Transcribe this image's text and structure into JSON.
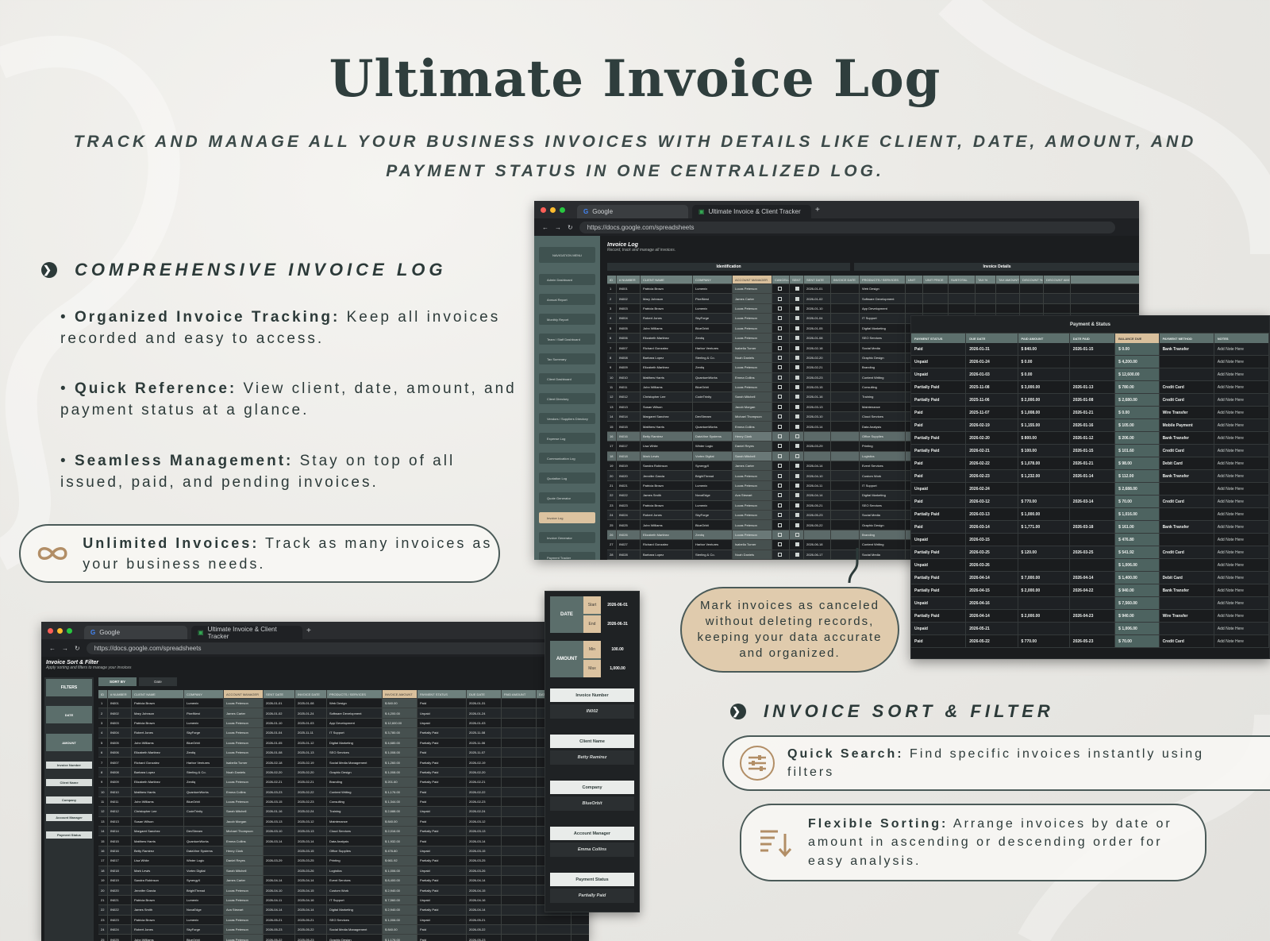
{
  "header": {
    "title": "Ultimate Invoice Log",
    "subtitle": "TRACK AND MANAGE ALL YOUR BUSINESS INVOICES WITH DETAILS LIKE CLIENT, DATE, AMOUNT, AND PAYMENT STATUS IN ONE CENTRALIZED LOG."
  },
  "section1": {
    "heading": "COMPREHENSIVE INVOICE LOG",
    "bullets": [
      {
        "bold": "Organized Invoice Tracking:",
        "text": " Keep all invoices recorded and easy to access."
      },
      {
        "bold": "Quick Reference:",
        "text": " View client, date, amount, and payment status at a glance."
      },
      {
        "bold": "Seamless Management:",
        "text": " Stay on top of all issued, paid, and pending invoices."
      }
    ],
    "pill": {
      "bold": "Unlimited Invoices:",
      "text": " Track as many invoices as your business needs.",
      "icon": "infinity-icon"
    }
  },
  "callout": "Mark invoices as canceled without deleting records, keeping your data accurate and organized.",
  "section2": {
    "heading": "INVOICE SORT & FILTER",
    "items": [
      {
        "bold": "Quick Search:",
        "text": " Find specific invoices instantly using filters",
        "icon": "sliders-icon"
      },
      {
        "bold": "Flexible Sorting:",
        "text": " Arrange invoices by date or amount in ascending or descending order for easy analysis.",
        "icon": "sort-icon"
      }
    ]
  },
  "browser_top": {
    "tab1": "Google",
    "tab2": "Ultimate Invoice & Client Tracker",
    "url": "https://docs.google.com/spreadsheets",
    "sheet_title": "Invoice Log",
    "sheet_subtitle": "Record, track and manage all invoices.",
    "group1": "Identification",
    "group2": "Invoice Details",
    "sidebar": [
      "NAVIGATION MENU",
      "Admin Dashboard",
      "Annual Report",
      "Monthly Report",
      "Team / Staff Dashboard",
      "Tax Summary",
      "Client Dashboard",
      "Client Directory",
      "Vendors / Suppliers Directory",
      "Expense Log",
      "Communication Log",
      "Quotation Log",
      "Quote Generator",
      "Invoice Log",
      "Invoice Generator",
      "Payment Tracker"
    ],
    "columns": [
      "ID",
      "# NUMBER",
      "CLIENT NAME",
      "COMPANY",
      "ACCOUNT MANAGER",
      "CANCELLED",
      "SENT",
      "SENT DATE",
      "INVOICE DATE",
      "PRODUCTS / SERVICES",
      "UNIT",
      "UNIT PRICE",
      "SUBTOTAL",
      "TAX %",
      "TAX AMOUNT",
      "DISCOUNT %",
      "DISCOUNT AMOUNT"
    ],
    "rows": [
      [
        "1",
        "IN001",
        "Patricia Brown",
        "Lumenix",
        "Lucas Peterson",
        "2026-01-01",
        "Web Design"
      ],
      [
        "2",
        "IN002",
        "Mary Johnson",
        "PixelNest",
        "James Carter",
        "2026-01-02",
        "Software Development"
      ],
      [
        "3",
        "IN003",
        "Patricia Brown",
        "Lumenix",
        "Lucas Peterson",
        "2026-01-10",
        "App Development"
      ],
      [
        "4",
        "IN004",
        "Robert Jones",
        "SkyForge",
        "Lucas Peterson",
        "2026-01-04",
        "IT Support"
      ],
      [
        "5",
        "IN005",
        "John Williams",
        "BlueOrbit",
        "Lucas Peterson",
        "2026-01-05",
        "Digital Marketing"
      ],
      [
        "6",
        "IN006",
        "Elizabeth Martinez",
        "Zentiq",
        "Lucas Peterson",
        "2026-01-08",
        "SEO Services"
      ],
      [
        "7",
        "IN007",
        "Richard Gonzalez",
        "Harbor Ventures",
        "Isabella Turner",
        "2026-02-18",
        "Social Media"
      ],
      [
        "8",
        "IN008",
        "Barbara Lopez",
        "Sterling & Co.",
        "Noah Daniels",
        "2026-02-20",
        "Graphic Design"
      ],
      [
        "9",
        "IN009",
        "Elizabeth Martinez",
        "Zentiq",
        "Lucas Peterson",
        "2026-02-21",
        "Branding"
      ],
      [
        "10",
        "IN010",
        "Matthew Harris",
        "QuantumWorks",
        "Emma Collins",
        "2026-03-23",
        "Content Writing"
      ],
      [
        "11",
        "IN011",
        "John Williams",
        "BlueOrbit",
        "Lucas Peterson",
        "2026-03-15",
        "Consulting"
      ],
      [
        "12",
        "IN012",
        "Christopher Lee",
        "CodeTrinity",
        "Sarah Mitchell",
        "2026-01-16",
        "Training"
      ],
      [
        "13",
        "IN013",
        "Susan Wilson",
        "",
        "Jacob Morgan",
        "2026-03-13",
        "Maintenance"
      ],
      [
        "14",
        "IN014",
        "Margaret Sanchez",
        "DevStream",
        "Michael Thompson",
        "2026-03-10",
        "Cloud Services"
      ],
      [
        "15",
        "IN015",
        "Matthew Harris",
        "QuantumWorks",
        "Emma Collins",
        "2026-03-14",
        "Data Analysis"
      ],
      [
        "16",
        "IN016",
        "Betty Ramirez",
        "DataVine Systems",
        "Henry Clark",
        "",
        "Office Supplies"
      ],
      [
        "17",
        "IN017",
        "Lisa White",
        "Winter Logic",
        "Daniel Reyes",
        "2026-03-29",
        "Printing"
      ],
      [
        "18",
        "IN018",
        "Mark Lewis",
        "Vortex Digital",
        "Sarah Mitchell",
        "",
        "Logistics"
      ],
      [
        "19",
        "IN019",
        "Sandra Robinson",
        "SynergyX",
        "James Carter",
        "2026-04-14",
        "Event Services"
      ],
      [
        "20",
        "IN020",
        "Jennifer Garcia",
        "BrightThread",
        "Lucas Peterson",
        "2026-04-10",
        "Custom Work"
      ],
      [
        "21",
        "IN021",
        "Patricia Brown",
        "Lumenix",
        "Lucas Peterson",
        "2026-04-11",
        "IT Support"
      ],
      [
        "22",
        "IN022",
        "James Smith",
        "NovaEdge",
        "Ava Stewart",
        "2026-04-14",
        "Digital Marketing"
      ],
      [
        "23",
        "IN023",
        "Patricia Brown",
        "Lumenix",
        "Lucas Peterson",
        "2026-05-21",
        "SEO Services"
      ],
      [
        "24",
        "IN024",
        "Robert Jones",
        "SkyForge",
        "Lucas Peterson",
        "2026-05-23",
        "Social Media"
      ],
      [
        "25",
        "IN025",
        "John Williams",
        "BlueOrbit",
        "Lucas Peterson",
        "2026-05-22",
        "Graphic Design"
      ],
      [
        "26",
        "IN026",
        "Elizabeth Martinez",
        "Zentiq",
        "Lucas Peterson",
        "",
        "Branding"
      ],
      [
        "27",
        "IN027",
        "Richard Gonzalez",
        "Harbor Ventures",
        "Isabella Turner",
        "2026-06-18",
        "Content Writing"
      ],
      [
        "28",
        "IN028",
        "Barbara Lopez",
        "Sterling & Co.",
        "Noah Daniels",
        "2026-06-17",
        "Social Media"
      ]
    ]
  },
  "payment_status": {
    "title": "Payment & Status",
    "columns": [
      "PAYMENT STATUS",
      "DUE DATE",
      "PAID AMOUNT",
      "DATE PAID",
      "BALANCE DUE",
      "PAYMENT METHOD",
      "NOTES"
    ],
    "rows": [
      [
        "Paid",
        "2026-01-31",
        "$ 840.00",
        "2026-01-15",
        "$ 0.00",
        "Bank Transfer",
        "Add Note Here"
      ],
      [
        "Unpaid",
        "2026-01-24",
        "$ 0.00",
        "",
        "$ 4,200.00",
        "",
        "Add Note Here"
      ],
      [
        "Unpaid",
        "2026-01-03",
        "$ 0.00",
        "",
        "$ 12,600.00",
        "",
        "Add Note Here"
      ],
      [
        "Partially Paid",
        "2025-11-08",
        "$ 3,000.00",
        "2026-01-13",
        "$ 780.00",
        "Credit Card",
        "Add Note Here"
      ],
      [
        "Partially Paid",
        "2025-11-06",
        "$ 2,000.00",
        "2026-01-08",
        "$ 2,680.00",
        "Credit Card",
        "Add Note Here"
      ],
      [
        "Paid",
        "2025-11-07",
        "$ 1,008.00",
        "2026-01-21",
        "$ 0.00",
        "Wire Transfer",
        "Add Note Here"
      ],
      [
        "Paid",
        "2026-02-19",
        "$ 1,155.00",
        "2026-01-16",
        "$ 105.00",
        "Mobile Payment",
        "Add Note Here"
      ],
      [
        "Partially Paid",
        "2026-02-20",
        "$ 800.00",
        "2026-01-12",
        "$ 206.00",
        "Bank Transfer",
        "Add Note Here"
      ],
      [
        "Partially Paid",
        "2026-02-21",
        "$ 100.00",
        "2026-01-15",
        "$ 101.60",
        "Credit Card",
        "Add Note Here"
      ],
      [
        "Paid",
        "2026-02-22",
        "$ 1,078.00",
        "2026-01-21",
        "$ 98.00",
        "Debit Card",
        "Add Note Here"
      ],
      [
        "Paid",
        "2026-02-23",
        "$ 1,232.00",
        "2026-01-14",
        "$ 112.00",
        "Bank Transfer",
        "Add Note Here"
      ],
      [
        "Unpaid",
        "2026-02-24",
        "",
        "",
        "$ 2,688.00",
        "",
        "Add Note Here"
      ],
      [
        "Paid",
        "2026-03-12",
        "$ 770.00",
        "2026-03-14",
        "$ 70.00",
        "Credit Card",
        "Add Note Here"
      ],
      [
        "Partially Paid",
        "2026-03-13",
        "$ 1,000.00",
        "",
        "$ 1,016.00",
        "",
        "Add Note Here"
      ],
      [
        "Paid",
        "2026-03-14",
        "$ 1,771.00",
        "2026-03-18",
        "$ 161.00",
        "Bank Transfer",
        "Add Note Here"
      ],
      [
        "Unpaid",
        "2026-03-15",
        "",
        "",
        "$ 476.80",
        "",
        "Add Note Here"
      ],
      [
        "Partially Paid",
        "2026-03-25",
        "$ 120.00",
        "2026-03-25",
        "$ 541.92",
        "Credit Card",
        "Add Note Here"
      ],
      [
        "Unpaid",
        "2026-03-26",
        "",
        "",
        "$ 1,006.00",
        "",
        "Add Note Here"
      ],
      [
        "Partially Paid",
        "2026-04-14",
        "$ 7,000.00",
        "2026-04-14",
        "$ 1,400.00",
        "Debit Card",
        "Add Note Here"
      ],
      [
        "Partially Paid",
        "2026-04-15",
        "$ 2,000.00",
        "2026-04-22",
        "$ 940.00",
        "Bank Transfer",
        "Add Note Here"
      ],
      [
        "Unpaid",
        "2026-04-16",
        "",
        "",
        "$ 7,560.00",
        "",
        "Add Note Here"
      ],
      [
        "Partially Paid",
        "2026-04-14",
        "$ 2,000.00",
        "2026-04-23",
        "$ 940.00",
        "Wire Transfer",
        "Add Note Here"
      ],
      [
        "Unpaid",
        "2026-05-21",
        "",
        "",
        "$ 1,006.00",
        "",
        "Add Note Here"
      ],
      [
        "Paid",
        "2026-05-22",
        "$ 770.00",
        "2026-05-23",
        "$ 70.00",
        "Credit Card",
        "Add Note Here"
      ]
    ]
  },
  "browser_bottom": {
    "tab1": "Google",
    "tab2": "Ultimate Invoice & Client Tracker",
    "url": "https://docs.google.com/spreadsheets",
    "sheet_title": "Invoice Sort & Filter",
    "sheet_subtitle": "Apply sorting and filters to manage your invoices",
    "sort_by": "SORT BY",
    "sort_value": "Date",
    "filters_label": "FILTERS",
    "side_filters": [
      "DATE",
      "AMOUNT",
      "Invoice Number",
      "Client Name",
      "Company",
      "Account Manager",
      "Payment Status"
    ],
    "columns": [
      "ID",
      "# NUMBER",
      "CLIENT NAME",
      "COMPANY",
      "ACCOUNT MANAGER",
      "SENT DATE",
      "INVOICE DATE",
      "PRODUCTS / SERVICES",
      "INVOICE AMOUNT",
      "PAYMENT STATUS",
      "DUE DATE",
      "PAID AMOUNT",
      "DATE PAID"
    ],
    "rows": [
      [
        "1",
        "IN001",
        "Patricia Brown",
        "Lumenix",
        "Lucas Peterson",
        "2026-01-01",
        "2025-01-08",
        "Web Design",
        "$ 840.00",
        "Paid",
        "2026-01-31"
      ],
      [
        "2",
        "IN002",
        "Mary Johnson",
        "PixelNest",
        "James Carter",
        "2026-01-02",
        "2025-01-24",
        "Software Development",
        "$ 4,200.00",
        "Unpaid",
        "2026-01-24"
      ],
      [
        "3",
        "IN003",
        "Patricia Brown",
        "Lumenix",
        "Lucas Peterson",
        "2026-01-10",
        "2025-01-03",
        "App Development",
        "$ 12,600.00",
        "Unpaid",
        "2026-01-03"
      ],
      [
        "4",
        "IN004",
        "Robert Jones",
        "SkyForge",
        "Lucas Peterson",
        "2026-01-04",
        "2025-11-11",
        "IT Support",
        "$ 3,780.00",
        "Partially Paid",
        "2025-11-08"
      ],
      [
        "5",
        "IN005",
        "John Williams",
        "BlueOrbit",
        "Lucas Peterson",
        "2026-01-05",
        "2025-01-12",
        "Digital Marketing",
        "$ 4,680.00",
        "Partially Paid",
        "2025-11-06"
      ],
      [
        "6",
        "IN006",
        "Elizabeth Martinez",
        "Zentiq",
        "Lucas Peterson",
        "2026-01-08",
        "2025-01-13",
        "SEO Services",
        "$ 1,008.00",
        "Paid",
        "2025-11-07"
      ],
      [
        "7",
        "IN007",
        "Richard Gonzalez",
        "Harbor Ventures",
        "Isabella Turner",
        "2026-02-18",
        "2025-02-19",
        "Social Media Management",
        "$ 1,260.00",
        "Partially Paid",
        "2026-02-19"
      ],
      [
        "8",
        "IN008",
        "Barbara Lopez",
        "Sterling & Co.",
        "Noah Daniels",
        "2026-02-20",
        "2025-02-20",
        "Graphic Design",
        "$ 1,008.00",
        "Partially Paid",
        "2026-02-20"
      ],
      [
        "9",
        "IN009",
        "Elizabeth Martinez",
        "Zentiq",
        "Lucas Peterson",
        "2026-02-21",
        "2025-02-21",
        "Branding",
        "$ 201.60",
        "Partially Paid",
        "2026-02-21"
      ],
      [
        "10",
        "IN010",
        "Matthew Harris",
        "QuantumWorks",
        "Emma Collins",
        "2026-03-23",
        "2025-02-22",
        "Content Writing",
        "$ 1,176.00",
        "Paid",
        "2026-02-22"
      ],
      [
        "11",
        "IN011",
        "John Williams",
        "BlueOrbit",
        "Lucas Peterson",
        "2026-03-15",
        "2025-02-23",
        "Consulting",
        "$ 1,344.00",
        "Paid",
        "2026-02-23"
      ],
      [
        "12",
        "IN012",
        "Christopher Lee",
        "CodeTrinity",
        "Sarah Mitchell",
        "2026-01-16",
        "2025-02-24",
        "Training",
        "$ 2,688.00",
        "Unpaid",
        "2026-02-24"
      ],
      [
        "13",
        "IN013",
        "Susan Wilson",
        "",
        "Jacob Morgan",
        "2026-03-13",
        "2025-03-12",
        "Maintenance",
        "$ 840.00",
        "Paid",
        "2026-03-12"
      ],
      [
        "14",
        "IN014",
        "Margaret Sanchez",
        "DevStream",
        "Michael Thompson",
        "2026-03-10",
        "2025-03-13",
        "Cloud Services",
        "$ 2,016.00",
        "Partially Paid",
        "2026-03-13"
      ],
      [
        "15",
        "IN015",
        "Matthew Harris",
        "QuantumWorks",
        "Emma Collins",
        "2026-03-14",
        "2025-03-14",
        "Data Analysis",
        "$ 1,932.00",
        "Paid",
        "2026-03-14"
      ],
      [
        "16",
        "IN016",
        "Betty Ramirez",
        "DataVine Systems",
        "Henry Clark",
        "",
        "2025-03-15",
        "Office Supplies",
        "$ 476.80",
        "Unpaid",
        "2026-03-15"
      ],
      [
        "17",
        "IN017",
        "Lisa White",
        "Winter Logic",
        "Daniel Reyes",
        "2026-03-29",
        "2025-03-25",
        "Printing",
        "$ 661.92",
        "Partially Paid",
        "2026-03-25"
      ],
      [
        "18",
        "IN018",
        "Mark Lewis",
        "Vortex Digital",
        "Sarah Mitchell",
        "",
        "2025-03-26",
        "Logistics",
        "$ 1,006.00",
        "Unpaid",
        "2026-03-26"
      ],
      [
        "19",
        "IN019",
        "Sandra Robinson",
        "SynergyX",
        "James Carter",
        "2026-04-14",
        "2025-04-14",
        "Event Services",
        "$ 8,400.00",
        "Partially Paid",
        "2026-04-14"
      ],
      [
        "20",
        "IN020",
        "Jennifer Garcia",
        "BrightThread",
        "Lucas Peterson",
        "2026-04-10",
        "2025-04-15",
        "Custom Work",
        "$ 2,940.00",
        "Partially Paid",
        "2026-04-15"
      ],
      [
        "21",
        "IN021",
        "Patricia Brown",
        "Lumenix",
        "Lucas Peterson",
        "2026-04-11",
        "2025-04-16",
        "IT Support",
        "$ 7,560.00",
        "Unpaid",
        "2026-04-16"
      ],
      [
        "22",
        "IN022",
        "James Smith",
        "NovaEdge",
        "Ava Stewart",
        "2026-04-14",
        "2025-04-14",
        "Digital Marketing",
        "$ 2,940.00",
        "Partially Paid",
        "2026-04-14"
      ],
      [
        "23",
        "IN023",
        "Patricia Brown",
        "Lumenix",
        "Lucas Peterson",
        "2026-05-21",
        "2025-05-21",
        "SEO Services",
        "$ 1,006.00",
        "Unpaid",
        "2026-05-21"
      ],
      [
        "24",
        "IN024",
        "Robert Jones",
        "SkyForge",
        "Lucas Peterson",
        "2026-05-23",
        "2025-05-22",
        "Social Media Management",
        "$ 840.00",
        "Paid",
        "2026-05-22"
      ],
      [
        "25",
        "IN025",
        "John Williams",
        "BlueOrbit",
        "Lucas Peterson",
        "2026-05-22",
        "2025-05-23",
        "Graphic Design",
        "$ 1,176.00",
        "Paid",
        "2026-05-23"
      ]
    ]
  },
  "filter_panel": {
    "date_label": "DATE",
    "start_label": "Start",
    "start_value": "2026-06-01",
    "end_label": "End",
    "end_value": "2026-06-31",
    "amount_label": "AMOUNT",
    "min_label": "Min",
    "min_value": "100.00",
    "max_label": "Max",
    "max_value": "1,000.00",
    "fields": [
      {
        "label": "Invoice Number",
        "value": "IN002"
      },
      {
        "label": "Client Name",
        "value": "Betty Ramirez"
      },
      {
        "label": "Company",
        "value": "BlueOrbit"
      },
      {
        "label": "Account Manager",
        "value": "Emma Collins"
      },
      {
        "label": "Payment Status",
        "value": "Partially Paid"
      }
    ]
  },
  "colors": {
    "accent": "#b28e66",
    "dark": "#2c3a39",
    "sheet_header": "#6e807d",
    "tan": "#dcc3a0"
  }
}
